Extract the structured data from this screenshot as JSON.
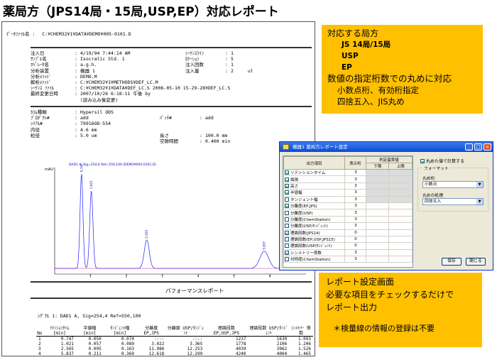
{
  "title": "薬局方（JPS14局・15局,USP,EP）対応レポート",
  "report": {
    "data_file_label": "ﾃﾞｰﾀﾌｧｲﾙ名 :",
    "data_file_value": "C:¥CHEM32¥1¥DATA¥DEMO¥005-0101.D",
    "left_fields": [
      {
        "k": "注入日",
        "v": "4/19/94 7:44:14 AM"
      },
      {
        "k": "ｻﾝﾌﾟﾙ名",
        "v": "Isocratic Std. 1"
      },
      {
        "k": "ｵﾍﾟﾚｰﾀ名",
        "v": "a.g.h."
      },
      {
        "k": "分析装置",
        "v": "機器 1"
      },
      {
        "k": "分析ﾒｿｯﾄﾞ",
        "v": "DEMO.M"
      },
      {
        "k": "解析ﾒｿｯﾄﾞ",
        "v": "C:¥CHEM32¥1¥METHODS¥DEF_LC.M"
      },
      {
        "k": "ｼｰｹﾝｽ ﾌｧｲﾙ",
        "v": "C:¥CHEM32¥1¥DATA¥DEF_LC.S 2006-05-10 15-29-28¥DEF_LC.S"
      },
      {
        "k": "最終変更日時",
        "v": "2007/10/26 6:18:11 午後 by"
      },
      {
        "k": "",
        "v": "(読み込み後変更)"
      }
    ],
    "right_fields": [
      {
        "k": "ｼｰｹﾝｽﾗｲﾝ",
        "v": "1"
      },
      {
        "k": "ﾛｹｰｼｮﾝ",
        "v": "5"
      },
      {
        "k": "注入回数",
        "v": "1"
      },
      {
        "k": "注入量",
        "v": "2",
        "u": "ul"
      }
    ],
    "column_fields": [
      {
        "k": "ｶﾗﾑ種類",
        "v": "Hypersil ODS"
      },
      {
        "k": "ﾌﾟﾛﾀﾞｸﾄ#",
        "v": "add"
      },
      {
        "k": "ｼﾘｱﾙ#",
        "v": "79916OD-554"
      },
      {
        "k": "内径",
        "v": "4.6 mm"
      },
      {
        "k": "粒径",
        "v": "5.0 um"
      }
    ],
    "column_fields_right": [
      {
        "k": "ﾊﾞｯﾁ#",
        "v": "add"
      },
      {
        "k": "長さ",
        "v": "100.0 mm"
      },
      {
        "k": "空隙時間",
        "v": "0.400 min"
      }
    ],
    "chrom_legend": "DAD1 A, Sig=254,4 Ref=550,100 (DEMO¥005-0101.D)",
    "chrom_ylabel": "mAU",
    "perf_title": "パフォーマンスレポート",
    "signal_line": "ｼｸﾞﾅﾙ 1:   DAD1 A, Sig=254,4 Ref=550,100",
    "perf_headers": [
      "No",
      "ﾘﾃﾝｼｮﾝﾀｲﾑ [min]",
      "半値幅 [min]",
      "ﾀﾝｼﾞｪﾝﾄ幅 [min]",
      "分離度 EP,JPS",
      "分離度 USP/ﾀﾝｼﾞｪﾝﾄ",
      "理論段数 EP,USP,JPS",
      "理論段数 USP/ﾀﾝｼﾞｪﾝﾄ",
      "ｼﾝﾒﾄﾘｰ 係数"
    ],
    "perf_rows": [
      [
        "1",
        "0.747",
        "0.050",
        "0.074",
        "----",
        "----",
        "1237",
        "1630",
        "1.093"
      ],
      [
        "2",
        "1.021",
        "0.057",
        "0.089",
        "3.022",
        "3.365",
        "1778",
        "2106",
        "1.206"
      ],
      [
        "3",
        "2.565",
        "0.095",
        "0.163",
        "11.986",
        "12.253",
        "4039",
        "3962",
        "1.526"
      ],
      [
        "4",
        "5.837",
        "0.211",
        "0.369",
        "12.618",
        "12.299",
        "4240",
        "4004",
        "1.465"
      ]
    ]
  },
  "chart_data": {
    "type": "line",
    "title": "DAD1 A, Sig=254,4 Ref=550,100 (DEMO¥005-0101.D)",
    "ylabel": "mAU",
    "xlabel": "",
    "xlim": [
      0,
      7
    ],
    "peaks": [
      {
        "rt": 0.747,
        "label": "0.747",
        "height": 1.0
      },
      {
        "rt": 1.021,
        "label": "1.021",
        "height": 0.82
      },
      {
        "rt": 2.565,
        "label": "2.565",
        "height": 0.3
      },
      {
        "rt": 5.837,
        "label": "5.837",
        "height": 0.18
      }
    ],
    "x_ticks": [
      "1",
      "2",
      "3",
      "4",
      "5",
      "6"
    ]
  },
  "callout_top": {
    "line1": "対応する局方",
    "line2": "JS 14局/15局",
    "line3": "USP",
    "line4": "EP",
    "line5": "数値の指定桁数での丸めに対応",
    "line6": "小数点桁、有効桁指定",
    "line7": "四捨五入、JIS丸め"
  },
  "callout_bottom": {
    "line1": "レポート設定画面",
    "line2": "必要な項目をチェックするだけで",
    "line3": "レポート出力",
    "note": "＊検量線の情報の登録は不要"
  },
  "dialog": {
    "title": "機器1  薬局方レポート設定",
    "col_item": "出力項目",
    "col_digits": "表示桁",
    "col_criteria": "判定基準値",
    "col_lower": "下限",
    "col_upper": "上限",
    "rows": [
      {
        "label": "リテンションタイム",
        "checked": true,
        "digits": "3"
      },
      {
        "label": "面積",
        "checked": true,
        "digits": "3"
      },
      {
        "label": "高さ",
        "checked": true,
        "digits": "3"
      },
      {
        "label": "半値幅",
        "checked": true,
        "digits": "3"
      },
      {
        "label": "タンジェント幅",
        "checked": false,
        "digits": "3"
      },
      {
        "label": "分離度(EP,JPS)",
        "checked": true,
        "digits": "3"
      },
      {
        "label": "分離度(USP)",
        "checked": false,
        "digits": "3"
      },
      {
        "label": "分離度(ChemStation)",
        "checked": false,
        "digits": "3"
      },
      {
        "label": "分離度(USP/ﾀﾝｼﾞｪﾝﾄ)",
        "checked": false,
        "digits": "3"
      },
      {
        "label": "理論段数(JPS14)",
        "checked": true,
        "digits": "0"
      },
      {
        "label": "理論段数(EP,USP,JPS15)",
        "checked": false,
        "digits": "0"
      },
      {
        "label": "理論段数(USP/ﾀﾝｼﾞｪﾝﾄ)",
        "checked": false,
        "digits": "0"
      },
      {
        "label": "シンメトリー係数",
        "checked": true,
        "digits": "3"
      },
      {
        "label": "対称度(ChemStation)",
        "checked": false,
        "digits": "3"
      }
    ],
    "round_check_label": "丸めた値で計算する",
    "format_group": "フォーマット",
    "round_digit_label": "丸め桁",
    "round_digit_value": "小数点",
    "round_proc_label": "丸めの処理",
    "round_proc_value": "四捨五入",
    "save_label": "保存",
    "close_label": "閉じる"
  }
}
